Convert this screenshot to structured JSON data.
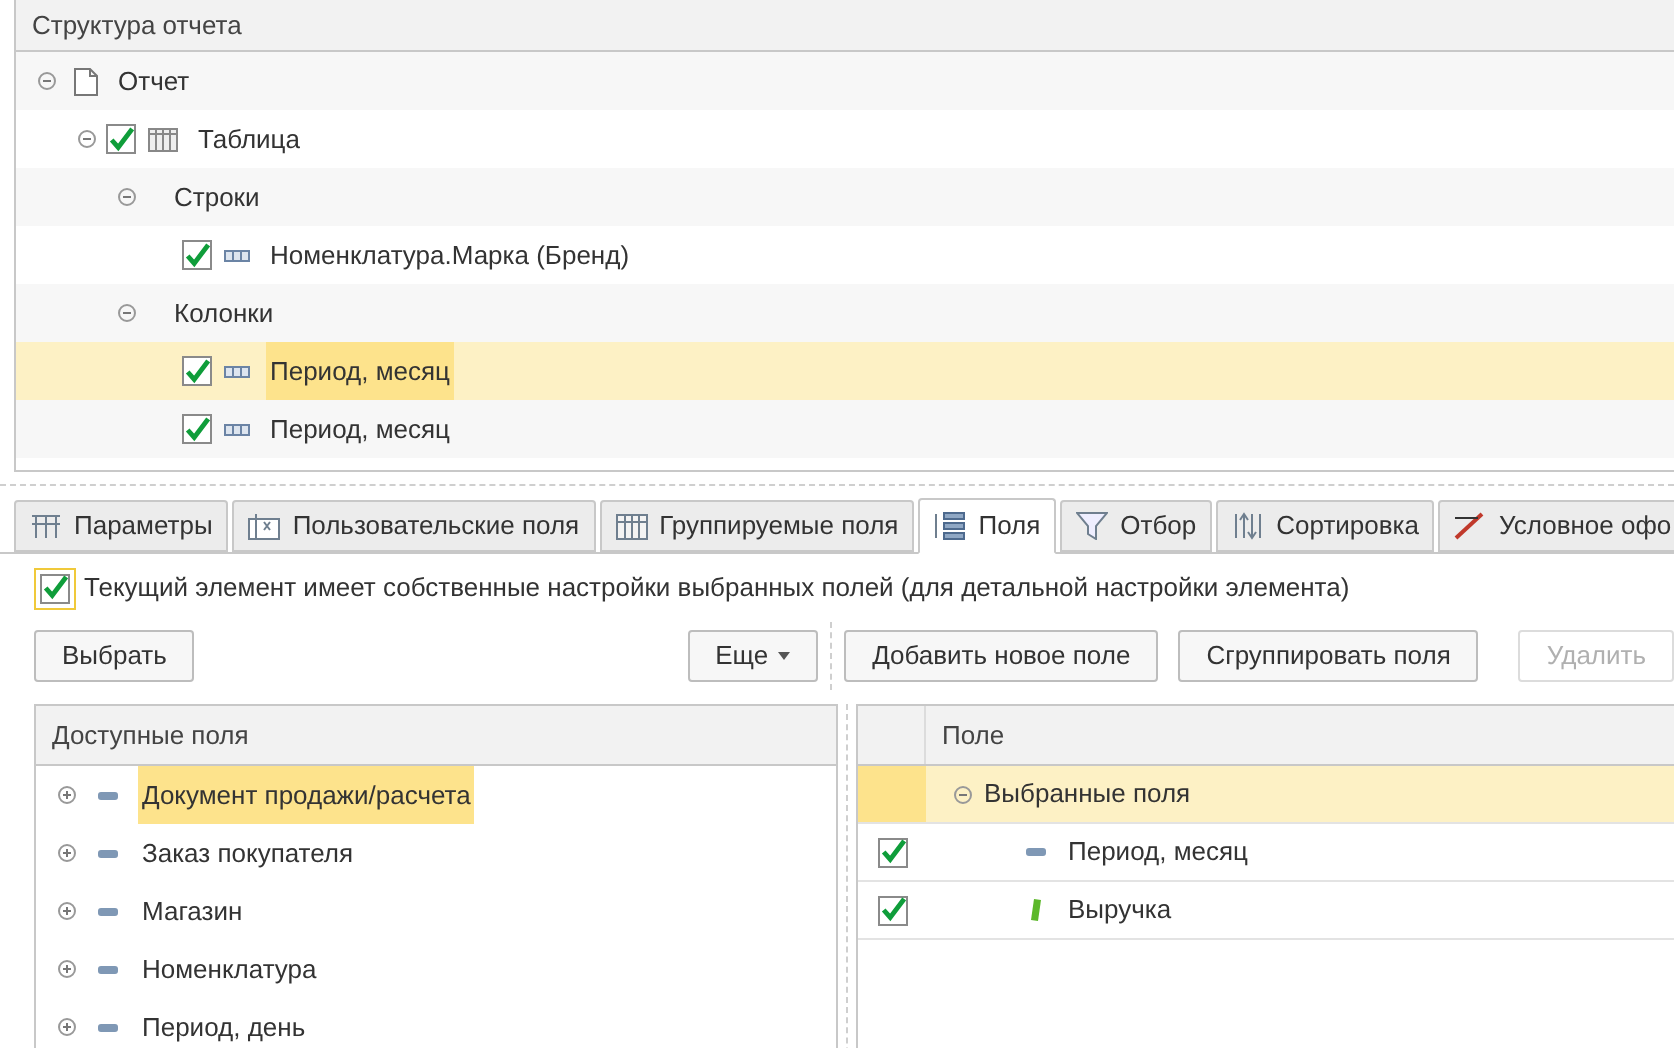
{
  "structure": {
    "title": "Структура отчета",
    "tree": [
      {
        "label": "Отчет",
        "kind": "report",
        "expanded": true,
        "selected": false,
        "children": [
          {
            "label": "Таблица",
            "kind": "table",
            "checked": true,
            "expanded": true,
            "selected": false,
            "children": [
              {
                "label": "Строки",
                "expanded": true,
                "selected": false,
                "children": [
                  {
                    "label": "Номенклатура.Марка (Бренд)",
                    "kind": "field",
                    "checked": true,
                    "selected": false
                  }
                ]
              },
              {
                "label": "Колонки",
                "expanded": true,
                "selected": false,
                "children": [
                  {
                    "label": "Период, месяц",
                    "kind": "field",
                    "checked": true,
                    "selected": true
                  },
                  {
                    "label": "Период, месяц",
                    "kind": "field",
                    "checked": true,
                    "selected": false
                  }
                ]
              }
            ]
          }
        ]
      }
    ]
  },
  "tabs": [
    {
      "label": "Параметры",
      "kind": "params",
      "selected": false
    },
    {
      "label": "Пользовательские поля",
      "kind": "formula",
      "selected": false
    },
    {
      "label": "Группируемые поля",
      "kind": "table",
      "selected": false
    },
    {
      "label": "Поля",
      "kind": "fields",
      "selected": true
    },
    {
      "label": "Отбор",
      "kind": "filter",
      "selected": false
    },
    {
      "label": "Сортировка",
      "kind": "sort",
      "selected": false
    },
    {
      "label": "Условное офо",
      "kind": "brush",
      "selected": false
    }
  ],
  "own_settings": {
    "label": "Текущий элемент имеет собственные настройки выбранных полей (для детальной настройки элемента)",
    "checked": true
  },
  "left_buttons": [
    {
      "label": "Выбрать",
      "kind": "plain",
      "disabled": false
    },
    {
      "label": "Еще",
      "kind": "menu",
      "disabled": false
    }
  ],
  "right_buttons": [
    {
      "label": "Добавить новое поле",
      "disabled": false
    },
    {
      "label": "Сгруппировать поля",
      "disabled": false
    },
    {
      "label": "Удалить",
      "disabled": true
    }
  ],
  "available": {
    "title": "Доступные поля",
    "items": [
      {
        "label": "Документ продажи/расчета",
        "selected": true
      },
      {
        "label": "Заказ покупателя",
        "selected": false
      },
      {
        "label": "Магазин",
        "selected": false
      },
      {
        "label": "Номенклатура",
        "selected": false
      },
      {
        "label": "Период, день",
        "selected": false
      }
    ]
  },
  "selected_fields": {
    "column": "Поле",
    "group": {
      "label": "Выбранные поля",
      "expanded": true,
      "selected": true,
      "children": [
        {
          "label": "Период, месяц",
          "kind": "dimension",
          "checked": true
        },
        {
          "label": "Выручка",
          "kind": "resource",
          "checked": true
        }
      ]
    }
  }
}
